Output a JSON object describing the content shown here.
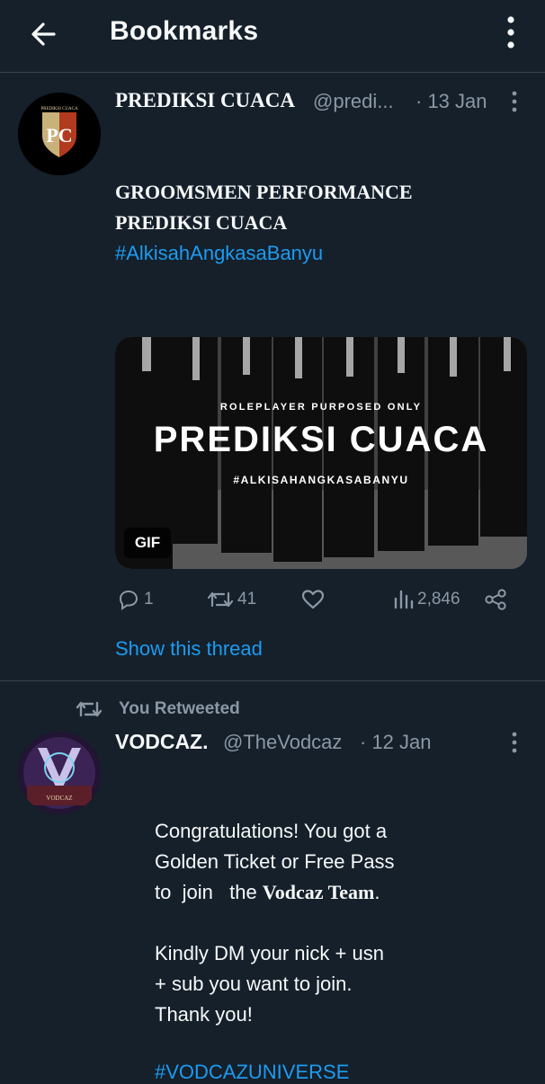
{
  "header": {
    "title": "Bookmarks"
  },
  "tweet1": {
    "name": "PREDIKSI CUACA",
    "handle": "@predi...",
    "date": "· 13 Jan",
    "avatar_text": {
      "top": "PREDIKSI CUACA",
      "monogram": "PC"
    },
    "text_line1": "GROOMSMEN PERFORMANCE",
    "text_line2": "PREDIKSI CUACA",
    "hashtag": "#AlkisahAngkasaBanyu",
    "media": {
      "line1": "ROLEPLAYER PURPOSED ONLY",
      "line2": "PREDIKSI CUACA",
      "line3": "#ALKISAHANGKASABANYU",
      "badge": "GIF"
    },
    "actions": {
      "replies": "1",
      "retweets": "41",
      "likes": "",
      "views": "2,846"
    },
    "show_thread": "Show this thread"
  },
  "tweet2": {
    "retweet_label": "You Retweeted",
    "name": "VODCAZ.",
    "handle": "@TheVodcaz",
    "date": "· 12 Jan",
    "avatar_text": "VODCAZ",
    "lines": [
      "Congratulations! You got a",
      "Golden Ticket or Free Pass",
      "to  join   the ",
      "Vodcaz Team",
      ".",
      "Kindly DM your nick + usn",
      "+ sub you want to join.",
      "Thank you!",
      "#VODCAZUNIVERSE"
    ]
  },
  "colors": {
    "background": "#15202b",
    "accent": "#1d9bf0",
    "muted": "#8b98a5",
    "divider": "#38444d"
  }
}
